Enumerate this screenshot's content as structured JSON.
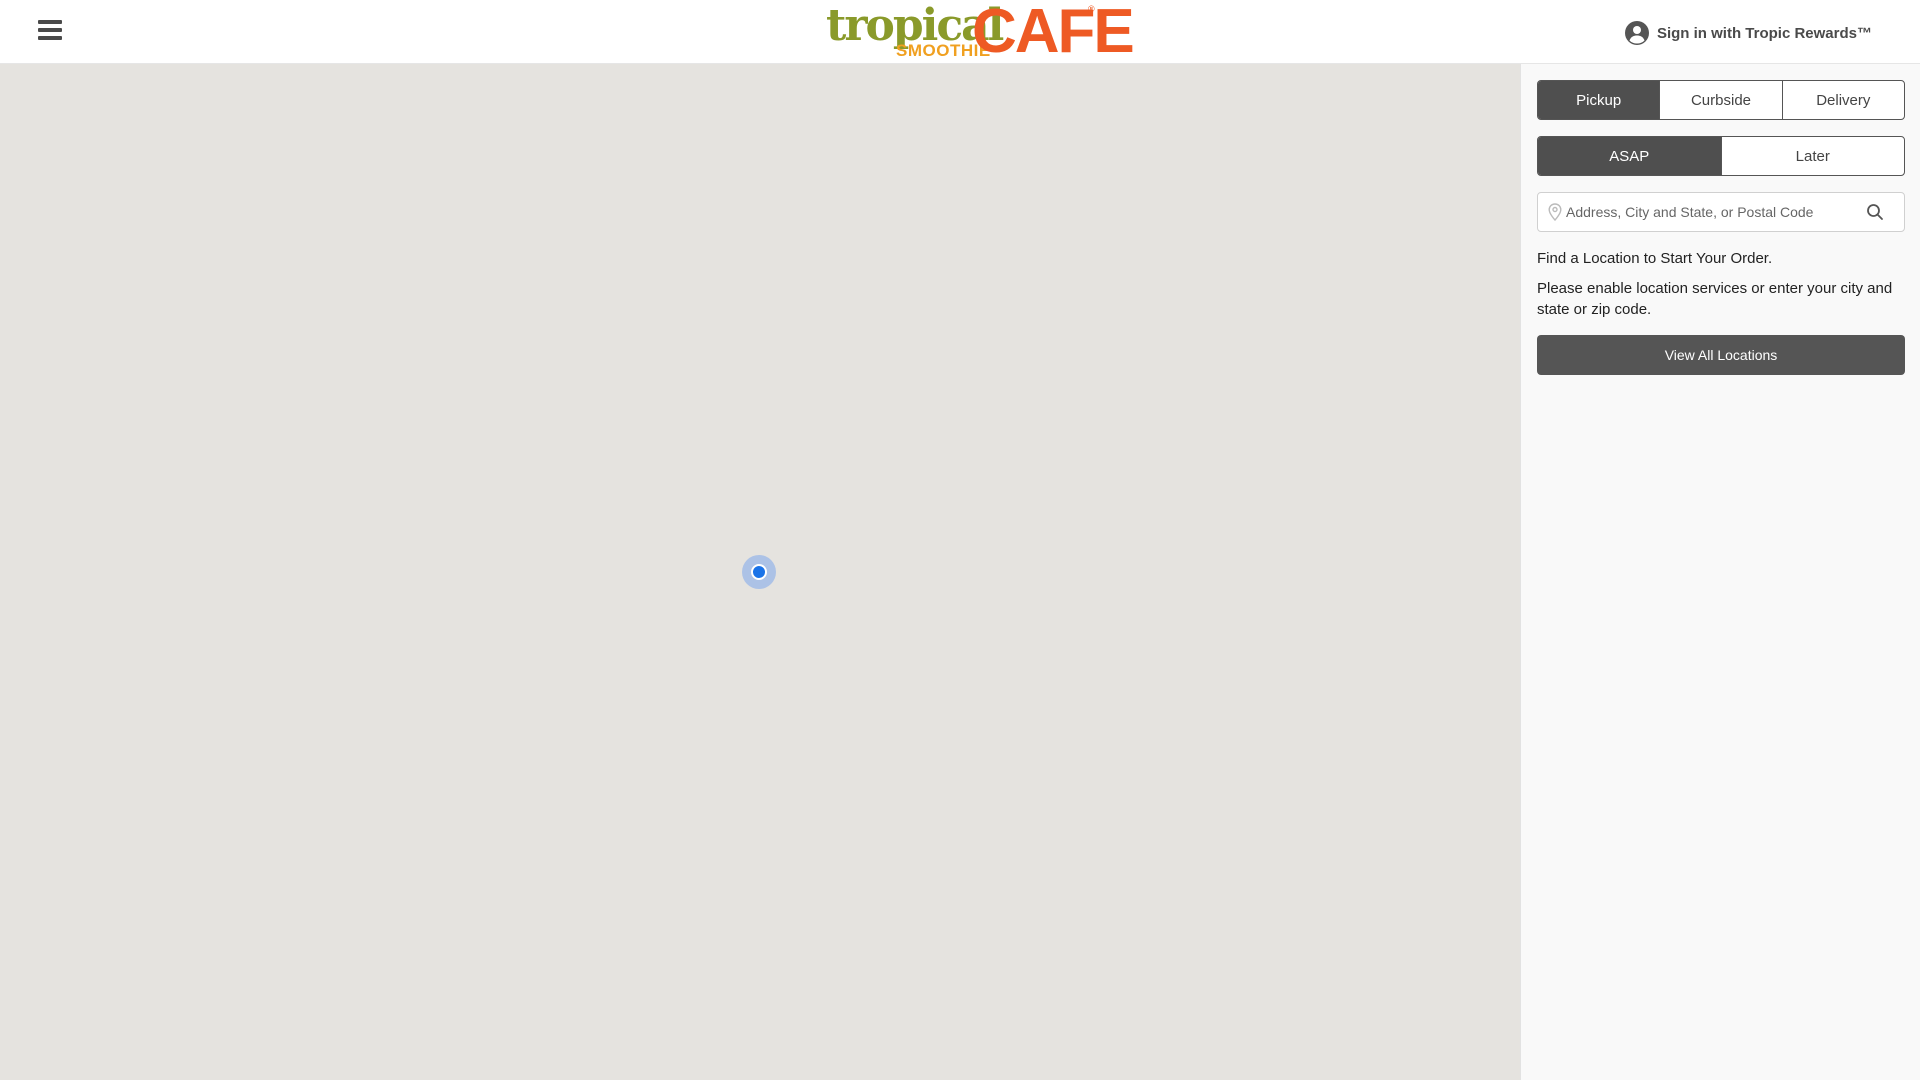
{
  "header": {
    "brand": {
      "line1": "tropical",
      "line2": "SMOOTHIE",
      "line3": "CAFE",
      "mark": "®"
    },
    "menu_icon": "hamburger-menu-icon",
    "signin": {
      "icon": "user-circle-icon",
      "label": "Sign in with Tropic Rewards™"
    }
  },
  "map": {
    "background_color": "#e5e3df",
    "marker": "current-location-dot"
  },
  "panel": {
    "order_types": [
      {
        "label": "Pickup",
        "active": true
      },
      {
        "label": "Curbside",
        "active": false
      },
      {
        "label": "Delivery",
        "active": false
      }
    ],
    "timing": [
      {
        "label": "ASAP",
        "active": true
      },
      {
        "label": "Later",
        "active": false
      }
    ],
    "search": {
      "placeholder": "Address, City and State, or Postal Code",
      "value": "",
      "pin_icon": "map-pin-icon",
      "search_icon": "magnifier-icon"
    },
    "find_title": "Find a Location to Start Your Order.",
    "find_desc": "Please enable location services or enter your city and state or zip code.",
    "view_all_label": "View All Locations"
  },
  "colors": {
    "brand_olive": "#8a9a2a",
    "brand_orange": "#ee5a24",
    "brand_yellow": "#f0a020",
    "active_segment": "#4f4f4f",
    "location_blue": "#1a73e8"
  }
}
